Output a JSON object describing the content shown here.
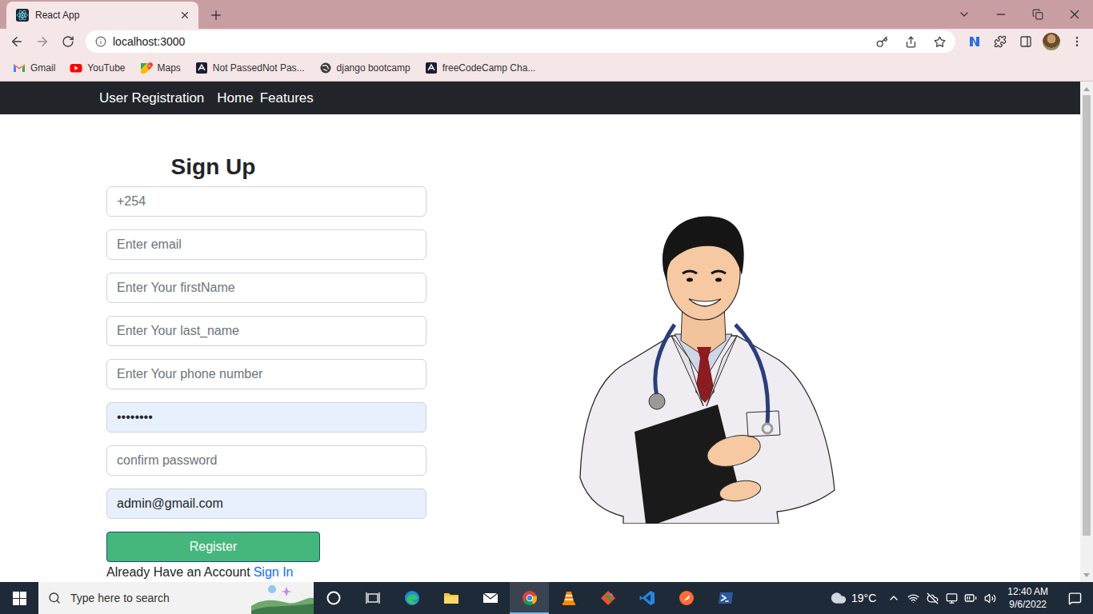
{
  "browser": {
    "tab": {
      "title": "React App",
      "selected": true
    },
    "address": "localhost:3000",
    "bookmarks": [
      "Gmail",
      "YouTube",
      "Maps",
      "Not PassedNot Pas...",
      "django bootcamp",
      "freeCodeCamp Cha..."
    ]
  },
  "navbar": {
    "brand": "User Registration",
    "links": [
      "Home",
      "Features"
    ]
  },
  "form": {
    "title": "Sign Up",
    "fields": [
      {
        "kind": "text",
        "placeholder": "+254",
        "value": "",
        "autofilled": false
      },
      {
        "kind": "text",
        "placeholder": "Enter email",
        "value": "",
        "autofilled": false
      },
      {
        "kind": "text",
        "placeholder": "Enter Your firstName",
        "value": "",
        "autofilled": false
      },
      {
        "kind": "text",
        "placeholder": "Enter Your last_name",
        "value": "",
        "autofilled": false
      },
      {
        "kind": "text",
        "placeholder": "Enter Your phone number",
        "value": "",
        "autofilled": false
      },
      {
        "kind": "password",
        "placeholder": "",
        "value": "••••••••",
        "autofilled": true
      },
      {
        "kind": "password",
        "placeholder": "confirm password",
        "value": "",
        "autofilled": false
      },
      {
        "kind": "text",
        "placeholder": "",
        "value": "admin@gmail.com",
        "autofilled": true
      }
    ],
    "submit": "Register",
    "footer": {
      "text": "Already Have an Account",
      "link": "Sign In"
    }
  },
  "scrollbar": {
    "level": 0.93
  },
  "taskbar": {
    "search": {
      "placeholder": "Type here to search"
    },
    "apps": [
      {
        "selected": false
      },
      {
        "selected": false
      },
      {
        "selected": false
      },
      {
        "selected": false
      },
      {
        "selected": false
      },
      {
        "selected": true
      },
      {
        "selected": false
      },
      {
        "selected": false
      },
      {
        "selected": false
      },
      {
        "selected": false
      },
      {
        "selected": false
      }
    ],
    "weather": "19°C",
    "time": "12:40 AM",
    "date": "9/6/2022"
  }
}
